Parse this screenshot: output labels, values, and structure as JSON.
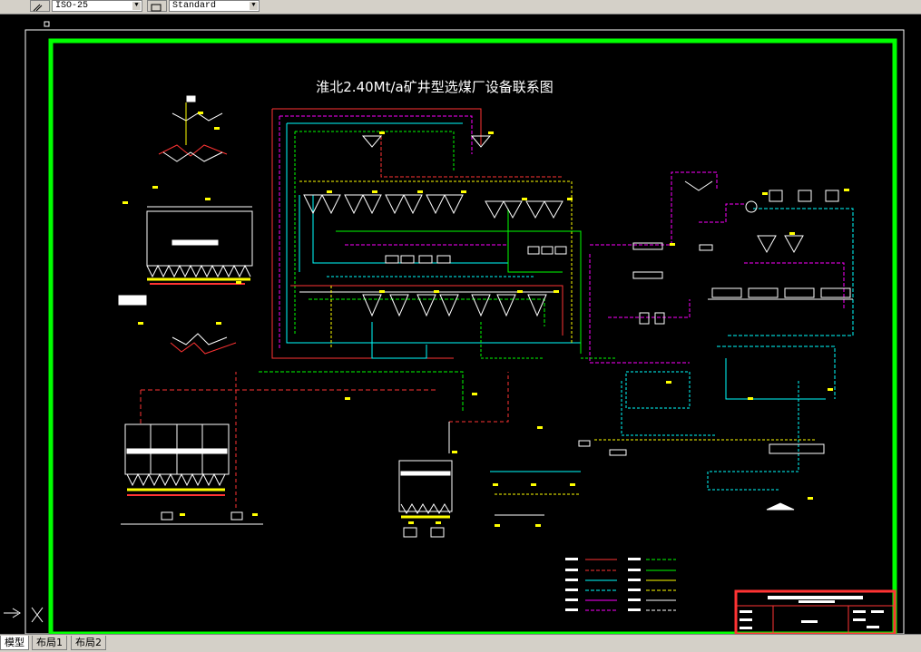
{
  "toolbar": {
    "dimstyle_value": "ISO-25",
    "textstyle_value": "Standard"
  },
  "drawing": {
    "title": "淮北2.40Mt/a矿井型选煤厂设备联系图",
    "background_color": "#000000",
    "frame_color": "#00ff00",
    "title_color": "#ffffff",
    "pipe_colors": [
      "#ff3333",
      "#00ffff",
      "#ff00ff",
      "#ffff00",
      "#00ff00",
      "#ffffff"
    ]
  },
  "tabs": [
    {
      "label": "模型",
      "active": true
    },
    {
      "label": "布局1",
      "active": false
    },
    {
      "label": "布局2",
      "active": false
    }
  ]
}
